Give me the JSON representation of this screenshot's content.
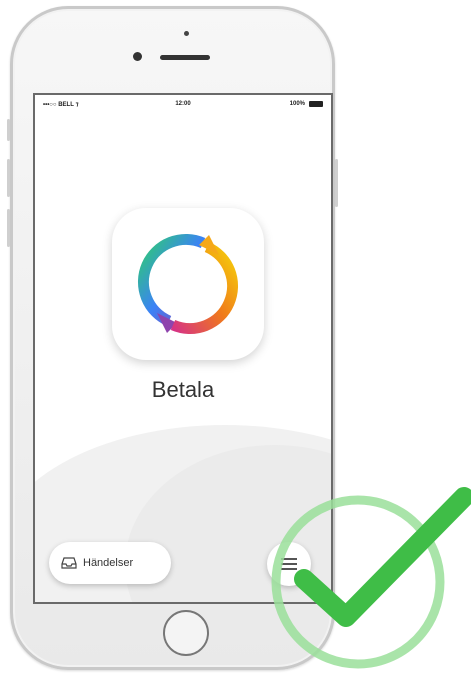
{
  "status_bar": {
    "carrier": "•••○○ BELL ⁊",
    "time": "12:00",
    "battery": "100%"
  },
  "app": {
    "name": "Betala"
  },
  "bottom_bar": {
    "events_label": "Händelser"
  },
  "icons": {
    "app_logo": "swish-ring-icon",
    "events": "inbox-icon",
    "menu": "hamburger-menu-icon",
    "overlay": "checkmark-icon"
  },
  "colors": {
    "check_green": "#3fbd47",
    "check_ring": "#9adf9a"
  }
}
